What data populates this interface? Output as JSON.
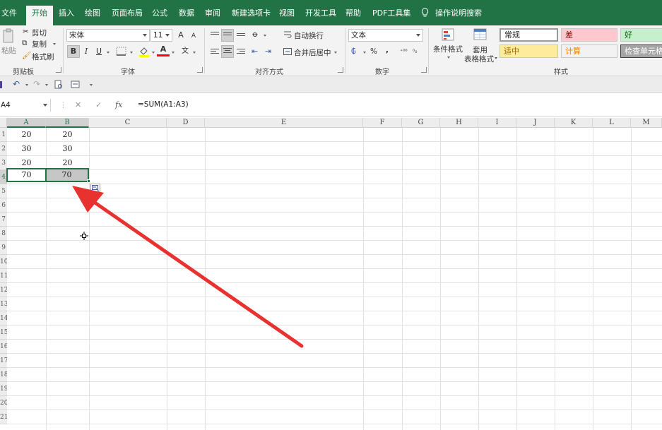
{
  "tabs": [
    {
      "label": "文件",
      "active": false
    },
    {
      "label": "开始",
      "active": true
    },
    {
      "label": "插入",
      "active": false
    },
    {
      "label": "绘图",
      "active": false
    },
    {
      "label": "页面布局",
      "active": false
    },
    {
      "label": "公式",
      "active": false
    },
    {
      "label": "数据",
      "active": false
    },
    {
      "label": "审阅",
      "active": false
    },
    {
      "label": "新建选项卡",
      "active": false
    },
    {
      "label": "视图",
      "active": false
    },
    {
      "label": "开发工具",
      "active": false
    },
    {
      "label": "帮助",
      "active": false
    },
    {
      "label": "PDF工具集",
      "active": false
    }
  ],
  "tell_me": "操作说明搜索",
  "ribbon": {
    "clipboard": {
      "paste": "粘贴",
      "cut": "剪切",
      "copy": "复制",
      "format_painter": "格式刷",
      "label": "剪贴板"
    },
    "font": {
      "name": "宋体",
      "size": "11",
      "grow": "A",
      "shrink": "A",
      "bold": "B",
      "italic": "I",
      "underline": "U",
      "color_a": "A",
      "wen": "文",
      "label": "字体"
    },
    "alignment": {
      "wrap": "自动换行",
      "merge": "合并后居中",
      "label": "对齐方式"
    },
    "number": {
      "format": "文本",
      "percent": "%",
      "comma": ",",
      "label": "数字"
    },
    "styles": {
      "conditional": "条件格式",
      "table_line1": "套用",
      "table_line2": "表格格式",
      "cells": [
        {
          "text": "常规",
          "bg": "#ffffff",
          "fg": "#222222"
        },
        {
          "text": "差",
          "bg": "#ffc7ce",
          "fg": "#9c0006"
        },
        {
          "text": "好",
          "bg": "#c6efce",
          "fg": "#006100"
        },
        {
          "text": "适中",
          "bg": "#ffeb9c",
          "fg": "#9c6500"
        },
        {
          "text": "计算",
          "bg": "#f2f2f2",
          "fg": "#fa7d00"
        },
        {
          "text": "检查单元格",
          "bg": "#a5a5a5",
          "fg": "#ffffff"
        }
      ],
      "label": "样式"
    }
  },
  "formula_bar": {
    "name_box": "A4",
    "cancel": "✕",
    "enter": "✓",
    "fx": "fx",
    "formula": "=SUM(A1:A3)"
  },
  "columns": [
    "A",
    "B",
    "C",
    "D",
    "E",
    "F",
    "G",
    "H",
    "I",
    "J",
    "K",
    "L",
    "M"
  ],
  "row_numbers": [
    "1",
    "2",
    "3",
    "4",
    "5",
    "6",
    "7",
    "8",
    "9",
    "10",
    "11",
    "12",
    "13",
    "14",
    "15",
    "16",
    "17",
    "18",
    "19",
    "20",
    "21"
  ],
  "rows": [
    {
      "a": "20",
      "b": "20"
    },
    {
      "a": "30",
      "b": "30"
    },
    {
      "a": "20",
      "b": "20"
    },
    {
      "a": "70",
      "b": "70"
    }
  ],
  "colors": {
    "accent": "#217346",
    "arrow": "#e8322f"
  }
}
